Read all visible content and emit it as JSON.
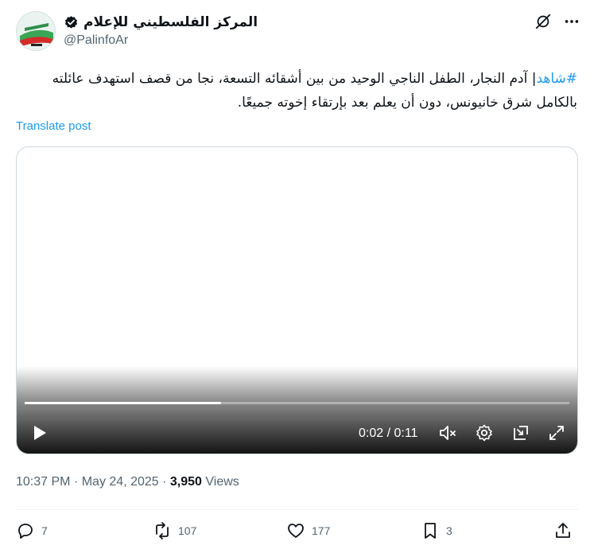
{
  "author": {
    "display_name": "المركز الفلسطيني للإعلام",
    "handle": "@PalinfoAr",
    "verified": true
  },
  "tweet": {
    "hashtag": "#شاهد",
    "text": "| آدم النجار، الطفل الناجي الوحيد من بين أشقائه التسعة، نجا من قصف استهدف عائلته بالكامل شرق خانيونس، دون أن يعلم بعد بإرتقاء إخوته جميعًا.",
    "translate_label": "Translate post"
  },
  "video": {
    "time_display": "0:02 / 0:11",
    "progress": 0.36
  },
  "meta": {
    "time": "10:37 PM",
    "separator1": "·",
    "date": "May 24, 2025",
    "separator2": "·",
    "views_count": "3,950",
    "views_label": "Views"
  },
  "actions": {
    "replies": "7",
    "reposts": "107",
    "likes": "177",
    "bookmarks": "3"
  },
  "colors": {
    "accent": "#1d9bf0",
    "text": "#0f1419",
    "muted": "#536471"
  }
}
